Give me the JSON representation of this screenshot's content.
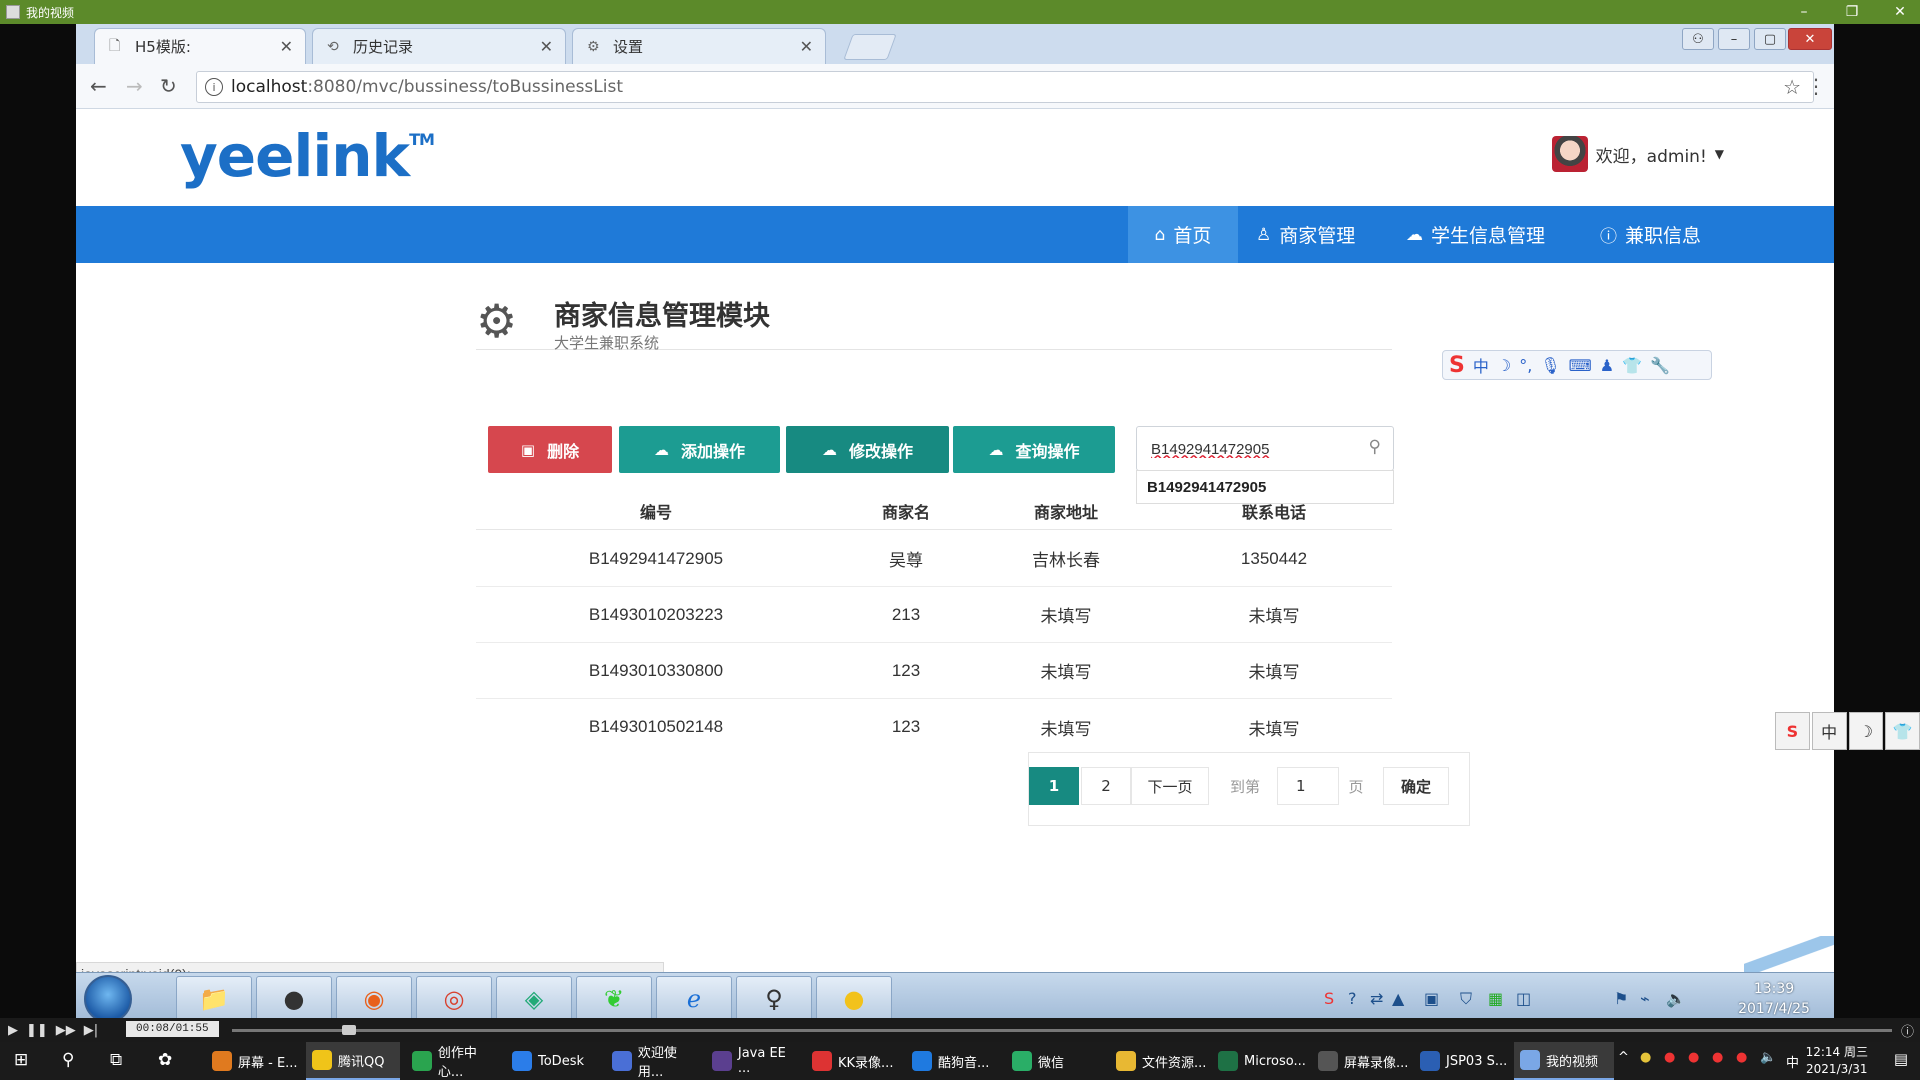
{
  "player": {
    "title": "我的视频",
    "time": "00:08/01:55"
  },
  "browser": {
    "tabs": [
      {
        "label": "H5模版:",
        "icon": "page-icon"
      },
      {
        "label": "历史记录",
        "icon": "history-icon"
      },
      {
        "label": "设置",
        "icon": "gear-icon"
      }
    ],
    "url_host": "localhost",
    "url_path": ":8080/mvc/bussiness/toBussinessList",
    "status_url": "javascript:void(0);"
  },
  "site": {
    "logo": "yeelink",
    "logo_tm": "TM",
    "welcome": "欢迎，admin!",
    "nav": [
      {
        "label": "首页",
        "icon": "home-icon"
      },
      {
        "label": "商家管理",
        "icon": "sitemap-icon"
      },
      {
        "label": "学生信息管理",
        "icon": "cloud-icon"
      },
      {
        "label": "兼职信息",
        "icon": "info-icon"
      }
    ]
  },
  "module": {
    "title": "商家信息管理模块",
    "subtitle": "大学生兼职系统"
  },
  "toolbar": {
    "delete_label": "删除",
    "add_label": "添加操作",
    "modify_label": "修改操作",
    "query_label": "查询操作",
    "search_value": "B1492941472905",
    "suggestion": "B1492941472905"
  },
  "table": {
    "headers": [
      "编号",
      "商家名",
      "商家地址",
      "联系电话"
    ],
    "rows": [
      [
        "B1492941472905",
        "吴尊",
        "吉林长春",
        "1350442"
      ],
      [
        "B1493010203223",
        "213",
        "未填写",
        "未填写"
      ],
      [
        "B1493010330800",
        "123",
        "未填写",
        "未填写"
      ],
      [
        "B1493010502148",
        "123",
        "未填写",
        "未填写"
      ]
    ]
  },
  "pager": {
    "pages": [
      "1",
      "2"
    ],
    "next": "下一页",
    "goto": "到第",
    "page_input": "1",
    "page_unit": "页",
    "confirm": "确定"
  },
  "inner_taskbar": {
    "time": "13:39",
    "date": "2017/4/25"
  },
  "taskbar": {
    "items": [
      {
        "label": "屏幕 - E...",
        "color": "#e07a1f"
      },
      {
        "label": "腾讯QQ",
        "color": "#f0c419"
      },
      {
        "label": "创作中心...",
        "color": "#2aa44f"
      },
      {
        "label": "ToDesk",
        "color": "#2b7de9"
      },
      {
        "label": "欢迎使用...",
        "color": "#4a6fd6"
      },
      {
        "label": "Java EE ...",
        "color": "#5b3f8f"
      },
      {
        "label": "KK录像...",
        "color": "#d33"
      },
      {
        "label": "酷狗音...",
        "color": "#1f7ae0"
      },
      {
        "label": "微信",
        "color": "#2aae67"
      },
      {
        "label": "文件资源...",
        "color": "#e8b833"
      },
      {
        "label": "Microso...",
        "color": "#1e7145"
      },
      {
        "label": "屏幕录像...",
        "color": "#555"
      },
      {
        "label": "JSP03 S...",
        "color": "#2b5fb3"
      },
      {
        "label": "我的视频",
        "color": "#7aa7e6"
      }
    ],
    "time": "12:14 周三",
    "date": "2021/3/31",
    "lang": "中"
  }
}
